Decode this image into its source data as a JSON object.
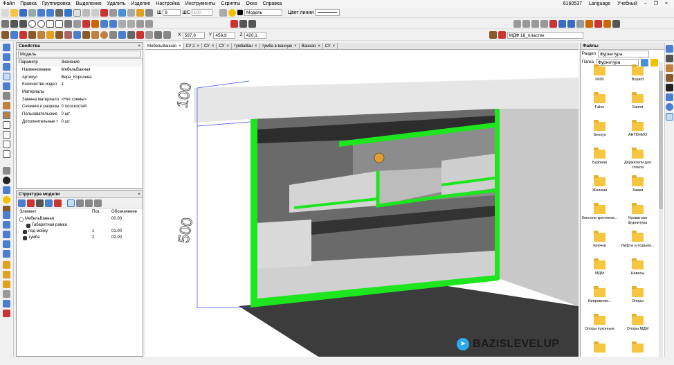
{
  "menu": [
    "Файл",
    "Правка",
    "Группировка",
    "Выделение",
    "Удалить",
    "Изделие",
    "Настройка",
    "Инструменты",
    "Скрипты",
    "Окно",
    "Справка"
  ],
  "menu_right": {
    "id": "6160537",
    "language": "Language",
    "mode": "Учебный"
  },
  "toolbar1": {
    "line_width_label": "Ш",
    "line_width": "8",
    "shc_label": "ШС",
    "shc_value": "100",
    "layer": "Модель",
    "line_color_label": "Цвет линии"
  },
  "coords": {
    "x_label": "X",
    "x": "597,6",
    "y_label": "Y",
    "y": "456,9",
    "z_label": "Z",
    "z": "420,1"
  },
  "material_label": "МДФ 18_пластик",
  "properties": {
    "title": "Свойства",
    "close": "×",
    "filter": "Модель",
    "col_param": "Параметр",
    "col_value": "Значение",
    "rows": [
      [
        "Наименование",
        "МебельВанная"
      ],
      [
        "Артикул",
        "Вера_Королева"
      ],
      [
        "Количество издел",
        "1"
      ],
      [
        "Материалы",
        ""
      ],
      [
        "Замена материало",
        "<Нет схемы>"
      ],
      [
        "Сечения и разрезы",
        "0 плоскостей"
      ],
      [
        "Пользовательские",
        "0 шт."
      ],
      [
        "Дополнительные т",
        "0 шт."
      ]
    ]
  },
  "structure": {
    "title": "Структура модели",
    "close": "×",
    "col_elem": "Элемент",
    "col_pos": "Поз.",
    "col_des": "Обозначение",
    "rows": [
      {
        "name": "МебельВанная",
        "pos": "",
        "des": "00.00",
        "indent": 0
      },
      {
        "name": "Габаритная рамка",
        "pos": "",
        "des": "",
        "indent": 2
      },
      {
        "name": "под мойку",
        "pos": "1",
        "des": "01.00",
        "indent": 1
      },
      {
        "name": "тумба",
        "pos": "2",
        "des": "02.00",
        "indent": 1
      }
    ]
  },
  "tabs": [
    "МебельВанная",
    "СУ 2",
    "СУ",
    "СУ",
    "тумбаВан",
    "тумба в ванную",
    "Ванная",
    "СУ"
  ],
  "tab_close": "×",
  "dimensions": {
    "top": "100",
    "bottom": "500"
  },
  "files": {
    "title": "Файлы",
    "section_label": "Раздел",
    "section": "Фурнитура",
    "folder_label": "Папка",
    "folder": "Фурнитура",
    "items": [
      "0600",
      "Boyard",
      "Falso",
      "Samet",
      "Sensys",
      "АНТОНИО",
      "Базовая",
      "Держатели для стекла",
      "Жалюзи",
      "Замки",
      "Консоли креплени...",
      "Кроватная фурнитура",
      "Крючки",
      "Лифты и подъем...",
      "МДМ",
      "Навесы",
      "Направляю...",
      "Опоры",
      "Опоры кухонные",
      "Опоры МДМ",
      "",
      ""
    ]
  },
  "brand": "BAZISLEVELUP",
  "colors": {
    "edge_green": "#1ee61e",
    "panel_grey": "#c8c8c8",
    "dark_floor": "#3c3c3c",
    "folder_yellow": "#f6c640"
  }
}
